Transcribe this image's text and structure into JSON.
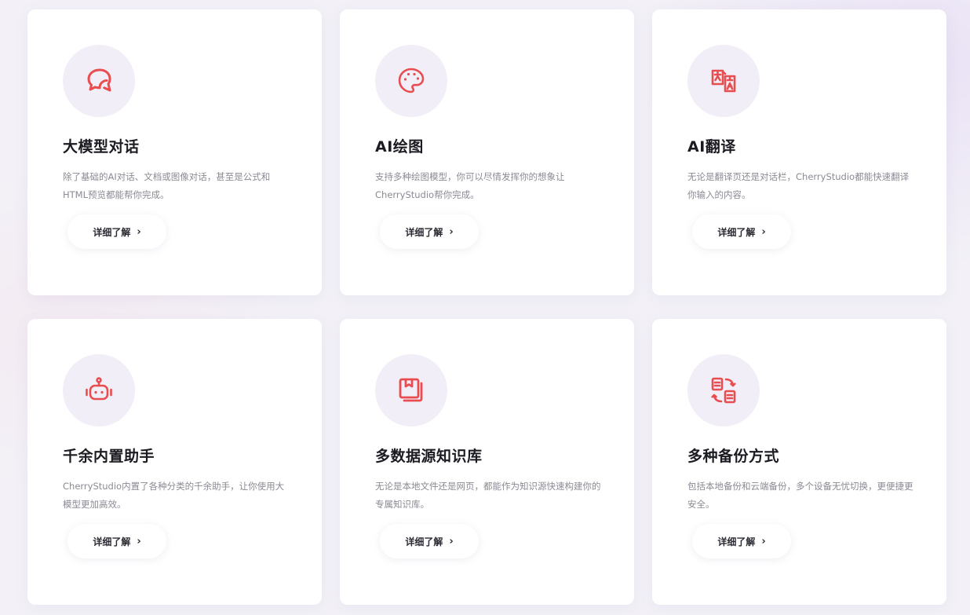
{
  "colors": {
    "accent": "#e84d4f",
    "icon_bg": "#f2eef8",
    "card_bg": "#ffffff",
    "page_bg": "#f3f1f7"
  },
  "cards": [
    {
      "icon": "chat-bubbles-icon",
      "title": "大模型对话",
      "description": "除了基础的AI对话、文档或图像对话，甚至是公式和HTML预览都能帮你完成。",
      "button_label": "详细了解",
      "button_arrow": "›"
    },
    {
      "icon": "palette-icon",
      "title": "AI绘图",
      "description": "支持多种绘图模型，你可以尽情发挥你的想象让CherryStudio帮你完成。",
      "button_label": "详细了解",
      "button_arrow": "›"
    },
    {
      "icon": "translate-icon",
      "title": "AI翻译",
      "description": "无论是翻译页还是对话栏，CherryStudio都能快速翻译你输入的内容。",
      "button_label": "详细了解",
      "button_arrow": "›"
    },
    {
      "icon": "robot-icon",
      "title": "千余内置助手",
      "description": "CherryStudio内置了各种分类的千余助手，让你使用大模型更加高效。",
      "button_label": "详细了解",
      "button_arrow": "›"
    },
    {
      "icon": "knowledge-base-icon",
      "title": "多数据源知识库",
      "description": "无论是本地文件还是网页，都能作为知识源快速构建你的专属知识库。",
      "button_label": "详细了解",
      "button_arrow": "›"
    },
    {
      "icon": "backup-sync-icon",
      "title": "多种备份方式",
      "description": "包括本地备份和云端备份，多个设备无忧切换，更便捷更安全。",
      "button_label": "详细了解",
      "button_arrow": "›"
    }
  ]
}
